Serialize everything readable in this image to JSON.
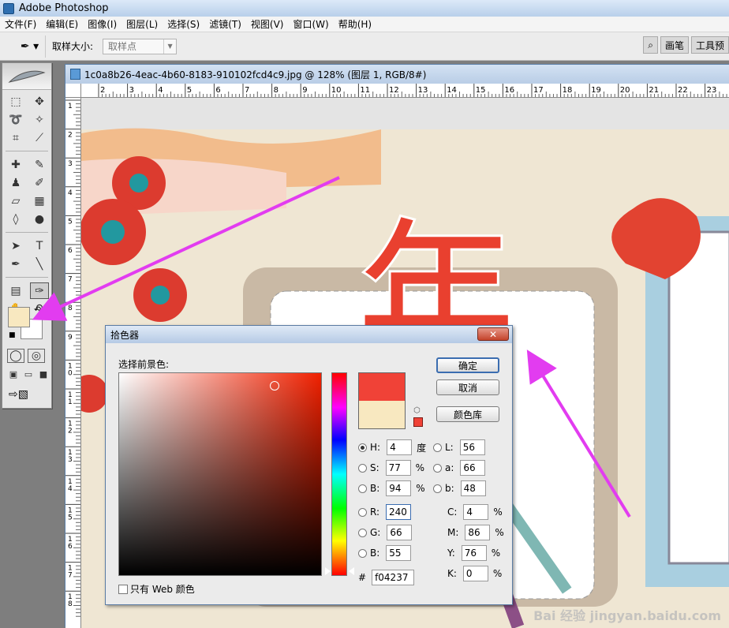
{
  "app": {
    "title": "Adobe Photoshop"
  },
  "menu": [
    "文件(F)",
    "编辑(E)",
    "图像(I)",
    "图层(L)",
    "选择(S)",
    "滤镜(T)",
    "视图(V)",
    "窗口(W)",
    "帮助(H)"
  ],
  "options": {
    "sample_label": "取样大小:",
    "sample_value": "取样点",
    "palette_tabs": [
      "画笔",
      "工具预"
    ]
  },
  "document": {
    "title": "1c0a8b26-4eac-4b60-8183-910102fcd4c9.jpg @ 128% (图层 1, RGB/8#)",
    "ruler_h": [
      "2",
      "3",
      "4",
      "5",
      "6",
      "7",
      "8",
      "9",
      "10",
      "11",
      "12",
      "13",
      "14",
      "15",
      "16",
      "17",
      "18",
      "19",
      "20",
      "21",
      "22",
      "23"
    ],
    "ruler_v": [
      "1",
      "2",
      "3",
      "4",
      "5",
      "6",
      "7",
      "8",
      "9",
      "10",
      "11",
      "12",
      "13",
      "14",
      "15",
      "16",
      "17",
      "18"
    ],
    "artwork_char": "年"
  },
  "dialog": {
    "title": "拾色器",
    "select_label": "选择前景色:",
    "buttons": {
      "ok": "确定",
      "cancel": "取消",
      "library": "颜色库"
    },
    "hsb": {
      "h_label": "H:",
      "h": "4",
      "h_unit": "度",
      "s_label": "S:",
      "s": "77",
      "s_unit": "%",
      "b_label": "B:",
      "b": "94",
      "b_unit": "%"
    },
    "rgb": {
      "r_label": "R:",
      "r": "240",
      "g_label": "G:",
      "g": "66",
      "b_label": "B:",
      "b": "55"
    },
    "lab": {
      "l_label": "L:",
      "l": "56",
      "a_label": "a:",
      "a": "66",
      "b_label": "b:",
      "b": "48"
    },
    "cmyk": {
      "c_label": "C:",
      "c": "4",
      "m_label": "M:",
      "m": "86",
      "y_label": "Y:",
      "y": "76",
      "k_label": "K:",
      "k": "0",
      "unit": "%"
    },
    "hex_label": "#",
    "hex": "f04237",
    "web_only": "只有 Web 颜色"
  },
  "colors": {
    "new": "#f04237",
    "current": "#f8e8c0",
    "accent": "#3b6db0"
  },
  "watermark": "Bai 经验 jingyan.baidu.com"
}
